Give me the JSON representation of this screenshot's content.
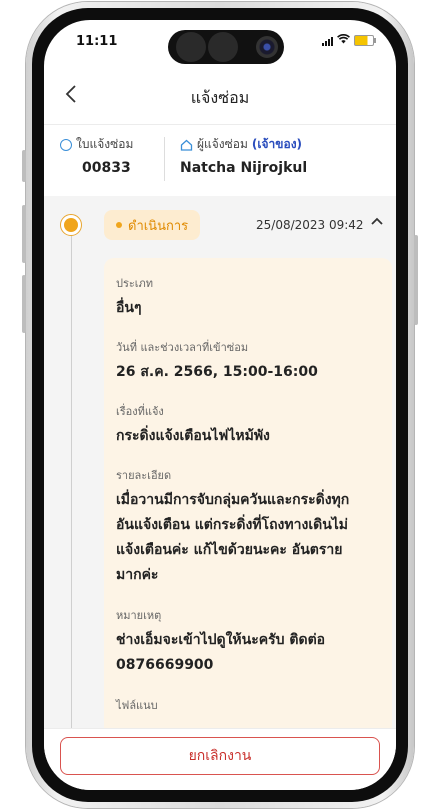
{
  "status_bar": {
    "time": "11:11"
  },
  "header": {
    "title": "แจ้งซ่อม",
    "back_icon": "chevron-left-icon"
  },
  "info": {
    "ticket_label": "ใบแจ้งซ่อม",
    "ticket_number": "00833",
    "reporter_label": "ผู้แจ้งซ่อม",
    "reporter_role": "(เจ้าของ)",
    "reporter_name": "Natcha Nijrojkul"
  },
  "timeline": {
    "status": "ดำเนินการ",
    "datetime": "25/08/2023 09:42",
    "status_color": "#F0A51C"
  },
  "details": {
    "type_label": "ประเภท",
    "type_value": "อื่นๆ",
    "date_label": "วันที่ และช่วงเวลาที่เข้าซ่อม",
    "date_value": "26 ส.ค. 2566, 15:00-16:00",
    "subject_label": "เรื่องที่แจ้ง",
    "subject_value": "กระดิ่งแจ้งเตือนไฟไหม้พัง",
    "desc_label": "รายละเอียด",
    "desc_lines": [
      "เมื่อวานมีการจับกลุ่มควันและกระดิ่งทุก",
      "อันแจ้งเตือน แต่กระดิ่งที่โถงทางเดินไม่",
      "แจ้งเตือนค่ะ แก้ไขด้วยนะคะ อันตราย",
      "มากค่ะ"
    ],
    "note_label": "หมายเหตุ",
    "note_lines": [
      "ช่างเอ็มจะเข้าไปดูให้นะครับ ติดต่อ",
      "0876669900"
    ],
    "attach_label": "ไฟล์แนบ"
  },
  "footer": {
    "cancel_label": "ยกเลิกงาน"
  }
}
